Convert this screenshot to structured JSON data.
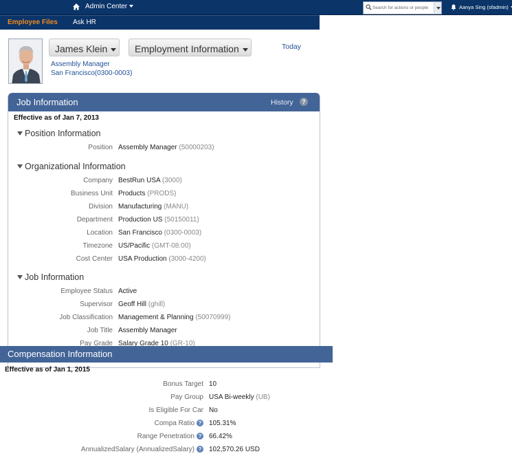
{
  "topbar": {
    "admin_center": "Admin Center",
    "search_placeholder": "Search for actions or people",
    "user": "Aanya Sing (sfadmin)"
  },
  "subnav": {
    "tabs": [
      "Employee Files",
      "Ask HR"
    ]
  },
  "profile": {
    "name": "James Klein",
    "view": "Employment Information",
    "today": "Today",
    "title": "Assembly Manager",
    "location": "San Francisco(0300-0003)"
  },
  "job_panel": {
    "title": "Job Information",
    "history": "History",
    "effective": "Effective as of Jan 7, 2013",
    "position_section": {
      "heading": "Position Information",
      "rows": [
        {
          "label": "Position",
          "value": "Assembly Manager",
          "code": "(50000203)"
        }
      ]
    },
    "org_section": {
      "heading": "Organizational Information",
      "rows": [
        {
          "label": "Company",
          "value": "BestRun USA",
          "code": "(3000)"
        },
        {
          "label": "Business Unit",
          "value": "Products",
          "code": "(PRODS)"
        },
        {
          "label": "Division",
          "value": "Manufacturing",
          "code": "(MANU)"
        },
        {
          "label": "Department",
          "value": "Production US",
          "code": "(50150011)"
        },
        {
          "label": "Location",
          "value": "San Francisco",
          "code": "(0300-0003)"
        },
        {
          "label": "Timezone",
          "value": "US/Pacific",
          "code": "(GMT-08:00)"
        },
        {
          "label": "Cost Center",
          "value": "USA Production",
          "code": "(3000-4200)"
        }
      ]
    },
    "job_section": {
      "heading": "Job Information",
      "rows": [
        {
          "label": "Employee Status",
          "value": "Active",
          "code": ""
        },
        {
          "label": "Supervisor",
          "value": "Geoff Hill",
          "code": "(ghill)"
        },
        {
          "label": "Job Classification",
          "value": "Management & Planning",
          "code": "(50070999)"
        },
        {
          "label": "Job Title",
          "value": "Assembly Manager",
          "code": ""
        },
        {
          "label": "Pay Grade",
          "value": "Salary Grade 10",
          "code": "(GR-10)"
        }
      ]
    }
  },
  "compensation": {
    "title": "Compensation Information",
    "effective": "Effective as of Jan 1, 2015",
    "rows": [
      {
        "label": "Bonus Target",
        "value": "10",
        "code": "",
        "help": false
      },
      {
        "label": "Pay Group",
        "value": "USA Bi-weekly",
        "code": "(UB)",
        "help": false
      },
      {
        "label": "Is Eligible For Car",
        "value": "No",
        "code": "",
        "help": false
      },
      {
        "label": "Compa Ratio",
        "value": "105.31%",
        "code": "",
        "help": true
      },
      {
        "label": "Range Penetration",
        "value": "66.42%",
        "code": "",
        "help": true
      },
      {
        "label": "AnnualizedSalary (AnnualizedSalary)",
        "value": "102,570.26 USD",
        "code": "",
        "help": true
      }
    ]
  },
  "colors": {
    "nav": "#0b3469",
    "panel_header": "#426497",
    "accent_orange": "#f28b1c",
    "link": "#1f4f96"
  }
}
